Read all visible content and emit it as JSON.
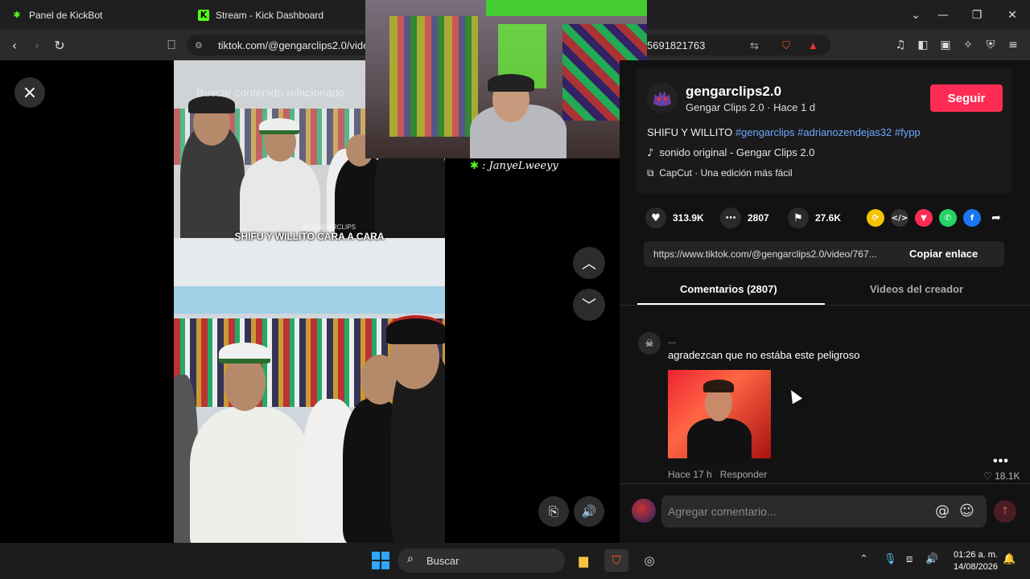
{
  "browser": {
    "tabs": [
      {
        "title": "Panel de KickBot"
      },
      {
        "title": "Stream - Kick Dashboard"
      }
    ],
    "url_visible": "tiktok.com/@gengarclips2.0/vide",
    "url_tail": "5691821763"
  },
  "video": {
    "search_overlay": "Buscar contenido relacionado",
    "caption": "SHIFU Y WILLITO CARA A CARA",
    "watermark": "@GENGARCLIPS"
  },
  "stream_overlay": {
    "viewer_name": ": JanyeLweeyy"
  },
  "post": {
    "username": "gengarclips2.0",
    "nickname_line": "Gengar Clips 2.0 · Hace 1 d",
    "follow_label": "Seguir",
    "description_text": "SHIFU Y WILLITO ",
    "hashtags": "#gengarclips #adrianozendejas32 #fypp",
    "music": "sonido original - Gengar Clips 2.0",
    "capcut": "CapCut · Una edición más fácil",
    "likes": "313.9K",
    "comments": "2807",
    "saves": "27.6K",
    "link": "https://www.tiktok.com/@gengarclips2.0/video/767...",
    "copy_label": "Copiar enlace"
  },
  "panel_tabs": {
    "comments": "Comentarios (2807)",
    "creator_videos": "Videos del creador"
  },
  "comment": {
    "author": "...",
    "text": "agradezcan que no estába este peligroso",
    "time": "Hace 17 h",
    "reply": "Responder",
    "likes": "18.1K"
  },
  "comment_input": {
    "placeholder": "Agregar comentario..."
  },
  "taskbar": {
    "search_label": "Buscar",
    "time": "01:26 a. m.",
    "date": "14/08/2026"
  },
  "colors": {
    "accent": "#fe2c55",
    "hashtag": "#6fa8ff",
    "panel_bg": "#121212"
  }
}
